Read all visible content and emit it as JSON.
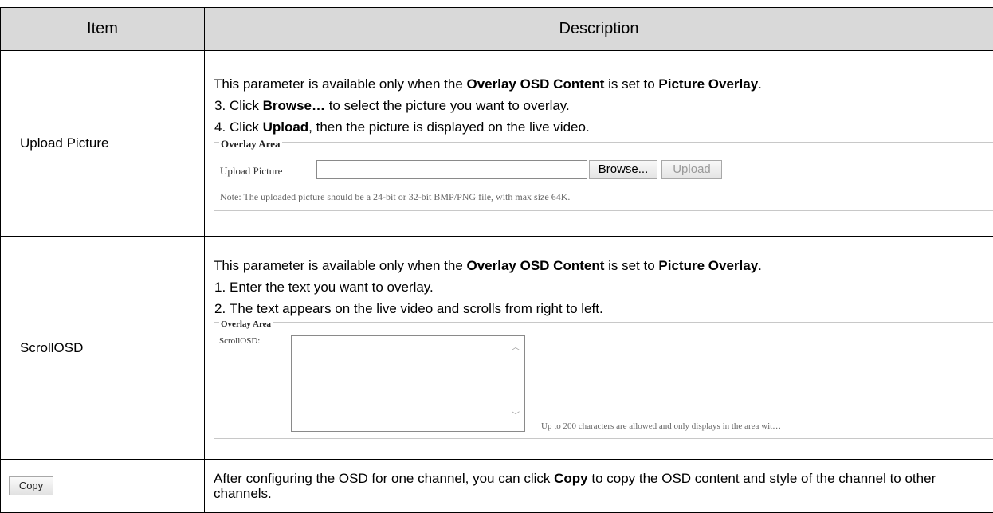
{
  "table": {
    "header_item": "Item",
    "header_description": "Description"
  },
  "row_upload": {
    "item": "Upload Picture",
    "para_pre": "This parameter is available only when the ",
    "para_b1": "Overlay OSD Content",
    "para_mid": " is set to ",
    "para_b2": "Picture Overlay",
    "para_post": ".",
    "step3_num": "3.",
    "step3_pre": "Click ",
    "step3_b": "Browse…",
    "step3_post": " to select the picture you want to overlay.",
    "step4_num": "4.",
    "step4_pre": "Click ",
    "step4_b": "Upload",
    "step4_post": ", then the picture is displayed on the live video.",
    "panel_legend": "Overlay Area",
    "panel_label": "Upload Picture",
    "panel_input_value": "",
    "browse_button": "Browse...",
    "upload_button": "Upload",
    "panel_note": "Note: The uploaded picture should be a 24-bit or 32-bit BMP/PNG file, with max size 64K."
  },
  "row_scroll": {
    "item": "ScrollOSD",
    "para_pre": "This parameter is available only when the ",
    "para_b1": "Overlay OSD Content",
    "para_mid": " is set to ",
    "para_b2": "Picture Overlay",
    "para_post": ".",
    "step1_num": "1.",
    "step1_text": "Enter the text you want to overlay.",
    "step2_num": "2.",
    "step2_text": "The text appears on the live video and scrolls from right to left.",
    "panel_legend": "Overlay Area",
    "panel_label": "ScrollOSD:",
    "panel_note": "Up to 200 characters are allowed and only displays in the area wit…"
  },
  "row_copy": {
    "item_button": "Copy",
    "desc_pre": "After configuring the OSD for one channel, you can click ",
    "desc_b": "Copy",
    "desc_post": " to copy the OSD content and style of the channel to other channels."
  }
}
